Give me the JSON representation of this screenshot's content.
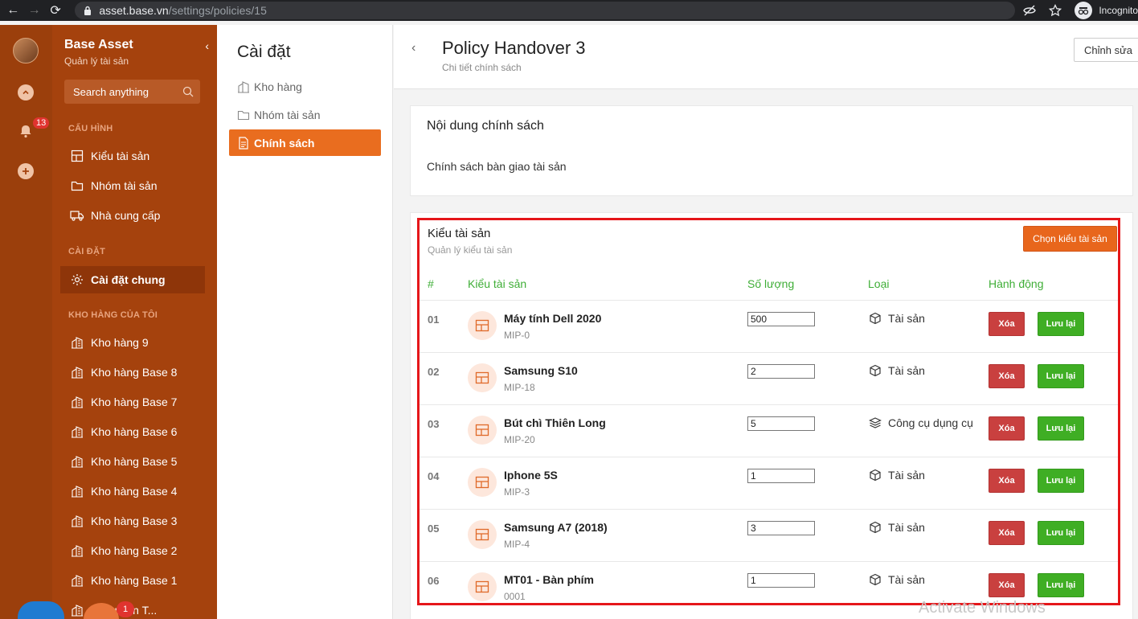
{
  "browser": {
    "url_host": "asset.base.vn",
    "url_path": "/settings/policies/15",
    "profile_label": "Incognito"
  },
  "rail": {
    "notification_count": "13"
  },
  "sidebar": {
    "title": "Base Asset",
    "subtitle": "Quản lý tài sản",
    "search_placeholder": "Search anything",
    "sections": [
      {
        "label": "CẤU HÌNH"
      },
      {
        "label": "CÀI ĐẶT"
      },
      {
        "label": "KHO HÀNG CỦA TÔI"
      }
    ],
    "config_items": [
      {
        "label": "Kiểu tài sản",
        "icon": "layout-icon"
      },
      {
        "label": "Nhóm tài sản",
        "icon": "folder-icon"
      },
      {
        "label": "Nhà cung cấp",
        "icon": "truck-icon"
      }
    ],
    "settings_items": [
      {
        "label": "Cài đặt chung",
        "icon": "gear-icon"
      }
    ],
    "warehouses": [
      {
        "label": "Kho hàng 9"
      },
      {
        "label": "Kho hàng Base 8"
      },
      {
        "label": "Kho hàng Base 7"
      },
      {
        "label": "Kho hàng Base 6"
      },
      {
        "label": "Kho hàng Base 5"
      },
      {
        "label": "Kho hàng Base 4"
      },
      {
        "label": "Kho hàng Base 3"
      },
      {
        "label": "Kho hàng Base 2"
      },
      {
        "label": "Kho hàng Base 1"
      },
      {
        "label": "g Nguyễn T..."
      }
    ],
    "floating_badge": "1"
  },
  "settings": {
    "title": "Cài đặt",
    "items": [
      {
        "label": "Kho hàng"
      },
      {
        "label": "Nhóm tài sản"
      },
      {
        "label": "Chính sách"
      }
    ]
  },
  "main": {
    "title": "Policy Handover 3",
    "subtitle": "Chi tiết chính sách",
    "edit_label": "Chỉnh sửa",
    "content_card": {
      "heading": "Nội dung chính sách",
      "body": "Chính sách bàn giao tài sản"
    },
    "asset_types": {
      "title": "Kiểu tài sản",
      "subtitle": "Quản lý kiểu tài sản",
      "choose_label": "Chọn kiểu tài sản",
      "columns": [
        "#",
        "Kiểu tài sản",
        "Số lượng",
        "Loại",
        "Hành động"
      ],
      "delete_label": "Xóa",
      "save_label": "Lưu lại",
      "rows": [
        {
          "idx": "01",
          "name": "Máy tính Dell 2020",
          "code": "MIP-0",
          "qty": "500",
          "type": "Tài sản",
          "type_icon": "box-icon"
        },
        {
          "idx": "02",
          "name": "Samsung S10",
          "code": "MIP-18",
          "qty": "2",
          "type": "Tài sản",
          "type_icon": "box-icon"
        },
        {
          "idx": "03",
          "name": "Bút chì Thiên Long",
          "code": "MIP-20",
          "qty": "5",
          "type": "Công cụ dụng cụ",
          "type_icon": "layers-icon"
        },
        {
          "idx": "04",
          "name": "Iphone 5S",
          "code": "MIP-3",
          "qty": "1",
          "type": "Tài sản",
          "type_icon": "box-icon"
        },
        {
          "idx": "05",
          "name": "Samsung A7 (2018)",
          "code": "MIP-4",
          "qty": "3",
          "type": "Tài sản",
          "type_icon": "box-icon"
        },
        {
          "idx": "06",
          "name": "MT01 - Bàn phím",
          "code": "0001",
          "qty": "1",
          "type": "Tài sản",
          "type_icon": "box-icon"
        }
      ]
    }
  },
  "watermark": "Activate Windows",
  "colors": {
    "sidebar": "#a5420d",
    "accent": "#e96d1f",
    "header_green": "#3fae37",
    "delete_red": "#c9403f",
    "save_green": "#3fae24",
    "highlight_red": "#e5161a"
  }
}
